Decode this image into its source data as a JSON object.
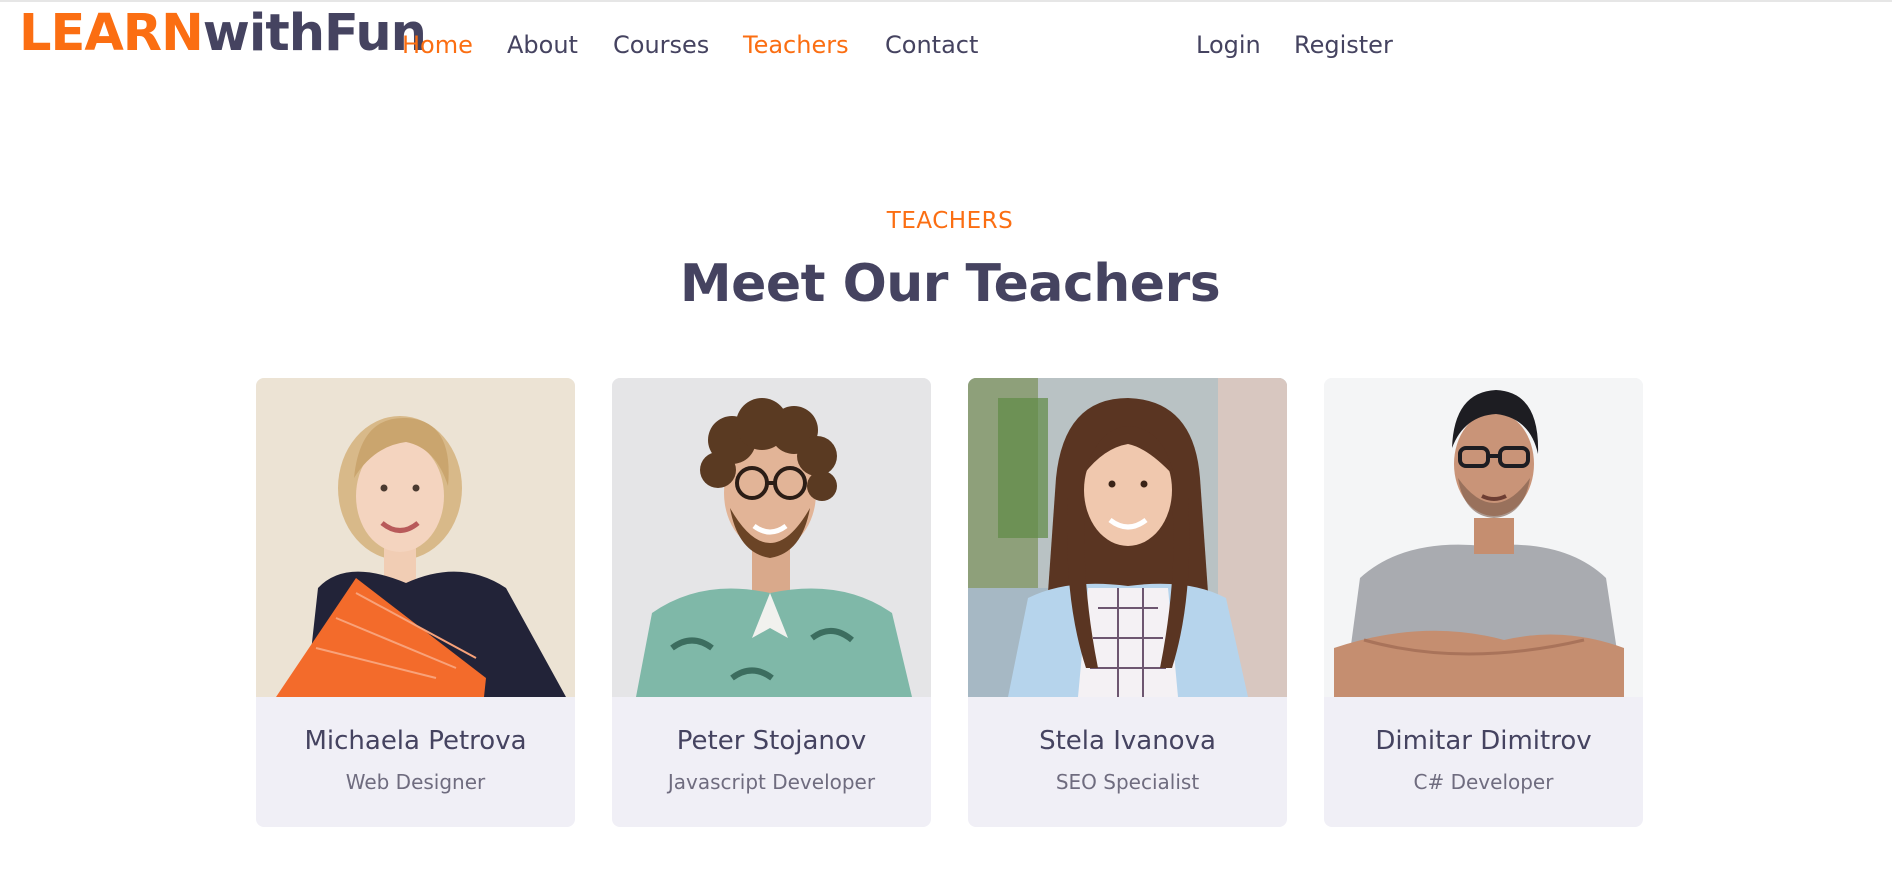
{
  "logo": {
    "part1": "LEARN",
    "part2": "withFun"
  },
  "nav": {
    "home": "Home",
    "about": "About",
    "courses": "Courses",
    "teachers": "Teachers",
    "contact": "Contact",
    "login": "Login",
    "register": "Register"
  },
  "colors": {
    "accent": "#fb6e12",
    "text": "#454360",
    "card_bg": "#f0eff6"
  },
  "section": {
    "subtitle": "TEACHERS",
    "title": "Meet Our Teachers"
  },
  "teachers": [
    {
      "name": "Michaela Petrova",
      "role": "Web Designer"
    },
    {
      "name": "Peter Stojanov",
      "role": "Javascript Developer"
    },
    {
      "name": "Stela Ivanova",
      "role": "SEO Specialist"
    },
    {
      "name": "Dimitar Dimitrov",
      "role": "C# Developer"
    }
  ]
}
